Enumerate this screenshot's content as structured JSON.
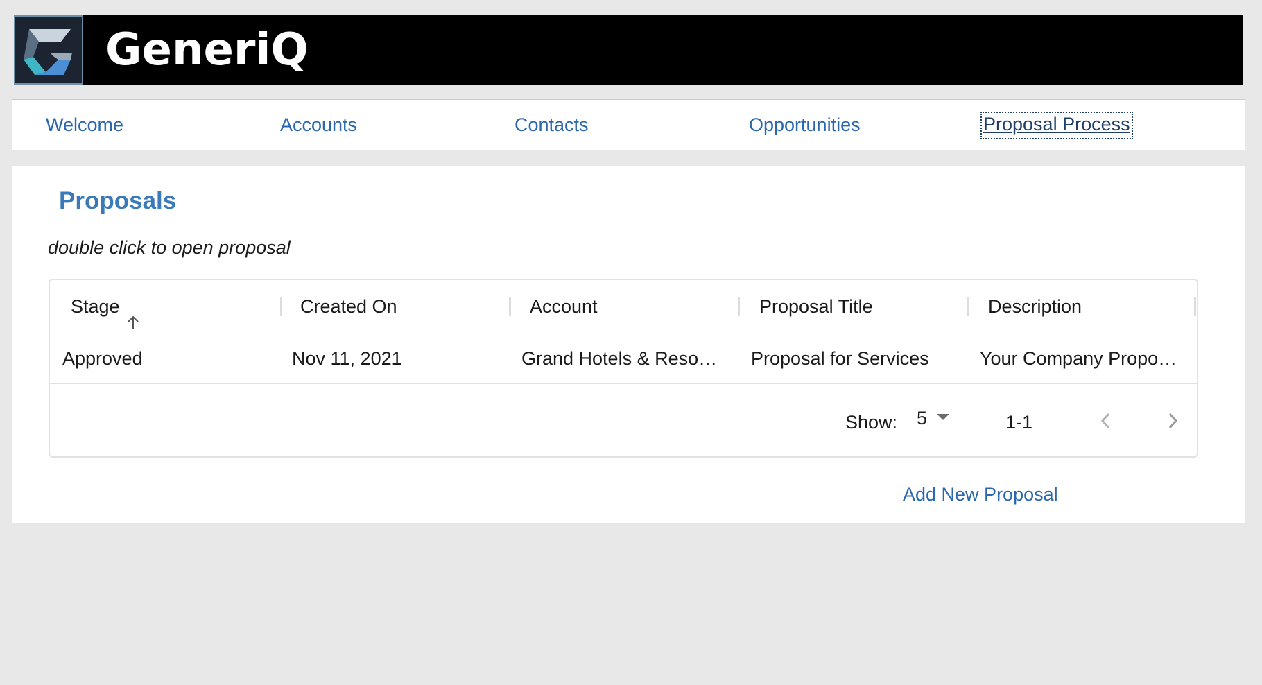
{
  "brand": {
    "name": "GeneriQ",
    "logo_icon": "generiq-logo-icon"
  },
  "nav": {
    "items": [
      {
        "label": "Welcome"
      },
      {
        "label": "Accounts"
      },
      {
        "label": "Contacts"
      },
      {
        "label": "Opportunities"
      },
      {
        "label": "Proposal Process"
      }
    ],
    "active": "Proposal Process"
  },
  "main": {
    "title": "Proposals",
    "hint": "double click to open proposal",
    "grid": {
      "columns": [
        {
          "label": "Stage",
          "sort": "ascending"
        },
        {
          "label": "Created On"
        },
        {
          "label": "Account"
        },
        {
          "label": "Proposal Title"
        },
        {
          "label": "Description"
        }
      ],
      "rows": [
        {
          "stage": "Approved",
          "created_on": "Nov 11, 2021",
          "account": "Grand Hotels & Reso…",
          "proposal_title": "Proposal for Services",
          "description": "Your Company Propo…"
        }
      ],
      "pagination": {
        "show_label": "Show:",
        "page_size": "5",
        "range": "1-1",
        "prev_icon": "chevron-left-icon",
        "next_icon": "chevron-right-icon"
      }
    },
    "add_label": "Add New Proposal"
  },
  "colors": {
    "header_bg": "#000000",
    "link": "#2a67ad",
    "title": "#3a7ab8",
    "page_bg": "#e8e8e8"
  }
}
